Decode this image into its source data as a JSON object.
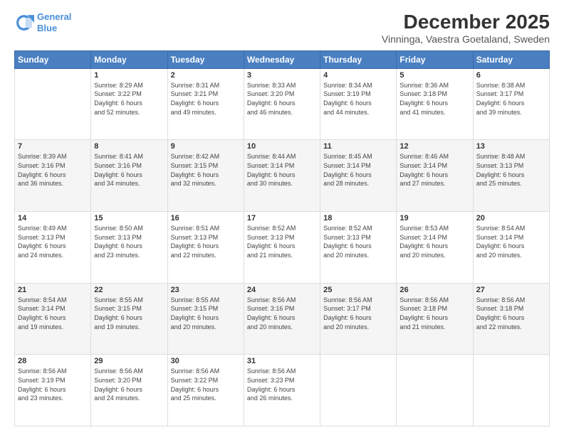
{
  "logo": {
    "line1": "General",
    "line2": "Blue"
  },
  "title": "December 2025",
  "subtitle": "Vinninga, Vaestra Goetaland, Sweden",
  "header_days": [
    "Sunday",
    "Monday",
    "Tuesday",
    "Wednesday",
    "Thursday",
    "Friday",
    "Saturday"
  ],
  "weeks": [
    [
      {
        "day": "",
        "info": ""
      },
      {
        "day": "1",
        "info": "Sunrise: 8:29 AM\nSunset: 3:22 PM\nDaylight: 6 hours\nand 52 minutes."
      },
      {
        "day": "2",
        "info": "Sunrise: 8:31 AM\nSunset: 3:21 PM\nDaylight: 6 hours\nand 49 minutes."
      },
      {
        "day": "3",
        "info": "Sunrise: 8:33 AM\nSunset: 3:20 PM\nDaylight: 6 hours\nand 46 minutes."
      },
      {
        "day": "4",
        "info": "Sunrise: 8:34 AM\nSunset: 3:19 PM\nDaylight: 6 hours\nand 44 minutes."
      },
      {
        "day": "5",
        "info": "Sunrise: 8:36 AM\nSunset: 3:18 PM\nDaylight: 6 hours\nand 41 minutes."
      },
      {
        "day": "6",
        "info": "Sunrise: 8:38 AM\nSunset: 3:17 PM\nDaylight: 6 hours\nand 39 minutes."
      }
    ],
    [
      {
        "day": "7",
        "info": "Sunrise: 8:39 AM\nSunset: 3:16 PM\nDaylight: 6 hours\nand 36 minutes."
      },
      {
        "day": "8",
        "info": "Sunrise: 8:41 AM\nSunset: 3:16 PM\nDaylight: 6 hours\nand 34 minutes."
      },
      {
        "day": "9",
        "info": "Sunrise: 8:42 AM\nSunset: 3:15 PM\nDaylight: 6 hours\nand 32 minutes."
      },
      {
        "day": "10",
        "info": "Sunrise: 8:44 AM\nSunset: 3:14 PM\nDaylight: 6 hours\nand 30 minutes."
      },
      {
        "day": "11",
        "info": "Sunrise: 8:45 AM\nSunset: 3:14 PM\nDaylight: 6 hours\nand 28 minutes."
      },
      {
        "day": "12",
        "info": "Sunrise: 8:46 AM\nSunset: 3:14 PM\nDaylight: 6 hours\nand 27 minutes."
      },
      {
        "day": "13",
        "info": "Sunrise: 8:48 AM\nSunset: 3:13 PM\nDaylight: 6 hours\nand 25 minutes."
      }
    ],
    [
      {
        "day": "14",
        "info": "Sunrise: 8:49 AM\nSunset: 3:13 PM\nDaylight: 6 hours\nand 24 minutes."
      },
      {
        "day": "15",
        "info": "Sunrise: 8:50 AM\nSunset: 3:13 PM\nDaylight: 6 hours\nand 23 minutes."
      },
      {
        "day": "16",
        "info": "Sunrise: 8:51 AM\nSunset: 3:13 PM\nDaylight: 6 hours\nand 22 minutes."
      },
      {
        "day": "17",
        "info": "Sunrise: 8:52 AM\nSunset: 3:13 PM\nDaylight: 6 hours\nand 21 minutes."
      },
      {
        "day": "18",
        "info": "Sunrise: 8:52 AM\nSunset: 3:13 PM\nDaylight: 6 hours\nand 20 minutes."
      },
      {
        "day": "19",
        "info": "Sunrise: 8:53 AM\nSunset: 3:14 PM\nDaylight: 6 hours\nand 20 minutes."
      },
      {
        "day": "20",
        "info": "Sunrise: 8:54 AM\nSunset: 3:14 PM\nDaylight: 6 hours\nand 20 minutes."
      }
    ],
    [
      {
        "day": "21",
        "info": "Sunrise: 8:54 AM\nSunset: 3:14 PM\nDaylight: 6 hours\nand 19 minutes."
      },
      {
        "day": "22",
        "info": "Sunrise: 8:55 AM\nSunset: 3:15 PM\nDaylight: 6 hours\nand 19 minutes."
      },
      {
        "day": "23",
        "info": "Sunrise: 8:55 AM\nSunset: 3:15 PM\nDaylight: 6 hours\nand 20 minutes."
      },
      {
        "day": "24",
        "info": "Sunrise: 8:56 AM\nSunset: 3:16 PM\nDaylight: 6 hours\nand 20 minutes."
      },
      {
        "day": "25",
        "info": "Sunrise: 8:56 AM\nSunset: 3:17 PM\nDaylight: 6 hours\nand 20 minutes."
      },
      {
        "day": "26",
        "info": "Sunrise: 8:56 AM\nSunset: 3:18 PM\nDaylight: 6 hours\nand 21 minutes."
      },
      {
        "day": "27",
        "info": "Sunrise: 8:56 AM\nSunset: 3:18 PM\nDaylight: 6 hours\nand 22 minutes."
      }
    ],
    [
      {
        "day": "28",
        "info": "Sunrise: 8:56 AM\nSunset: 3:19 PM\nDaylight: 6 hours\nand 23 minutes."
      },
      {
        "day": "29",
        "info": "Sunrise: 8:56 AM\nSunset: 3:20 PM\nDaylight: 6 hours\nand 24 minutes."
      },
      {
        "day": "30",
        "info": "Sunrise: 8:56 AM\nSunset: 3:22 PM\nDaylight: 6 hours\nand 25 minutes."
      },
      {
        "day": "31",
        "info": "Sunrise: 8:56 AM\nSunset: 3:23 PM\nDaylight: 6 hours\nand 26 minutes."
      },
      {
        "day": "",
        "info": ""
      },
      {
        "day": "",
        "info": ""
      },
      {
        "day": "",
        "info": ""
      }
    ]
  ]
}
